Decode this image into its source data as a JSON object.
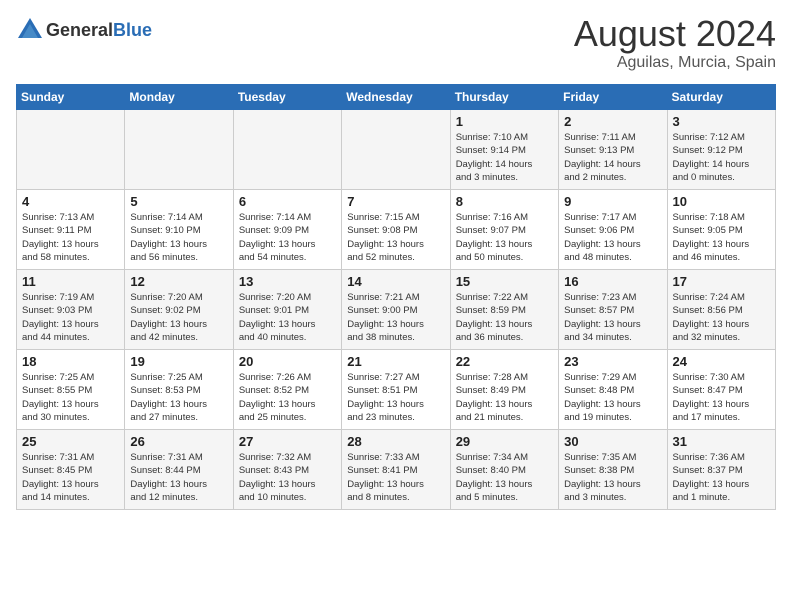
{
  "header": {
    "logo_general": "General",
    "logo_blue": "Blue",
    "month_year": "August 2024",
    "location": "Aguilas, Murcia, Spain"
  },
  "days_of_week": [
    "Sunday",
    "Monday",
    "Tuesday",
    "Wednesday",
    "Thursday",
    "Friday",
    "Saturday"
  ],
  "weeks": [
    [
      {
        "day": "",
        "info": ""
      },
      {
        "day": "",
        "info": ""
      },
      {
        "day": "",
        "info": ""
      },
      {
        "day": "",
        "info": ""
      },
      {
        "day": "1",
        "info": "Sunrise: 7:10 AM\nSunset: 9:14 PM\nDaylight: 14 hours\nand 3 minutes."
      },
      {
        "day": "2",
        "info": "Sunrise: 7:11 AM\nSunset: 9:13 PM\nDaylight: 14 hours\nand 2 minutes."
      },
      {
        "day": "3",
        "info": "Sunrise: 7:12 AM\nSunset: 9:12 PM\nDaylight: 14 hours\nand 0 minutes."
      }
    ],
    [
      {
        "day": "4",
        "info": "Sunrise: 7:13 AM\nSunset: 9:11 PM\nDaylight: 13 hours\nand 58 minutes."
      },
      {
        "day": "5",
        "info": "Sunrise: 7:14 AM\nSunset: 9:10 PM\nDaylight: 13 hours\nand 56 minutes."
      },
      {
        "day": "6",
        "info": "Sunrise: 7:14 AM\nSunset: 9:09 PM\nDaylight: 13 hours\nand 54 minutes."
      },
      {
        "day": "7",
        "info": "Sunrise: 7:15 AM\nSunset: 9:08 PM\nDaylight: 13 hours\nand 52 minutes."
      },
      {
        "day": "8",
        "info": "Sunrise: 7:16 AM\nSunset: 9:07 PM\nDaylight: 13 hours\nand 50 minutes."
      },
      {
        "day": "9",
        "info": "Sunrise: 7:17 AM\nSunset: 9:06 PM\nDaylight: 13 hours\nand 48 minutes."
      },
      {
        "day": "10",
        "info": "Sunrise: 7:18 AM\nSunset: 9:05 PM\nDaylight: 13 hours\nand 46 minutes."
      }
    ],
    [
      {
        "day": "11",
        "info": "Sunrise: 7:19 AM\nSunset: 9:03 PM\nDaylight: 13 hours\nand 44 minutes."
      },
      {
        "day": "12",
        "info": "Sunrise: 7:20 AM\nSunset: 9:02 PM\nDaylight: 13 hours\nand 42 minutes."
      },
      {
        "day": "13",
        "info": "Sunrise: 7:20 AM\nSunset: 9:01 PM\nDaylight: 13 hours\nand 40 minutes."
      },
      {
        "day": "14",
        "info": "Sunrise: 7:21 AM\nSunset: 9:00 PM\nDaylight: 13 hours\nand 38 minutes."
      },
      {
        "day": "15",
        "info": "Sunrise: 7:22 AM\nSunset: 8:59 PM\nDaylight: 13 hours\nand 36 minutes."
      },
      {
        "day": "16",
        "info": "Sunrise: 7:23 AM\nSunset: 8:57 PM\nDaylight: 13 hours\nand 34 minutes."
      },
      {
        "day": "17",
        "info": "Sunrise: 7:24 AM\nSunset: 8:56 PM\nDaylight: 13 hours\nand 32 minutes."
      }
    ],
    [
      {
        "day": "18",
        "info": "Sunrise: 7:25 AM\nSunset: 8:55 PM\nDaylight: 13 hours\nand 30 minutes."
      },
      {
        "day": "19",
        "info": "Sunrise: 7:25 AM\nSunset: 8:53 PM\nDaylight: 13 hours\nand 27 minutes."
      },
      {
        "day": "20",
        "info": "Sunrise: 7:26 AM\nSunset: 8:52 PM\nDaylight: 13 hours\nand 25 minutes."
      },
      {
        "day": "21",
        "info": "Sunrise: 7:27 AM\nSunset: 8:51 PM\nDaylight: 13 hours\nand 23 minutes."
      },
      {
        "day": "22",
        "info": "Sunrise: 7:28 AM\nSunset: 8:49 PM\nDaylight: 13 hours\nand 21 minutes."
      },
      {
        "day": "23",
        "info": "Sunrise: 7:29 AM\nSunset: 8:48 PM\nDaylight: 13 hours\nand 19 minutes."
      },
      {
        "day": "24",
        "info": "Sunrise: 7:30 AM\nSunset: 8:47 PM\nDaylight: 13 hours\nand 17 minutes."
      }
    ],
    [
      {
        "day": "25",
        "info": "Sunrise: 7:31 AM\nSunset: 8:45 PM\nDaylight: 13 hours\nand 14 minutes."
      },
      {
        "day": "26",
        "info": "Sunrise: 7:31 AM\nSunset: 8:44 PM\nDaylight: 13 hours\nand 12 minutes."
      },
      {
        "day": "27",
        "info": "Sunrise: 7:32 AM\nSunset: 8:43 PM\nDaylight: 13 hours\nand 10 minutes."
      },
      {
        "day": "28",
        "info": "Sunrise: 7:33 AM\nSunset: 8:41 PM\nDaylight: 13 hours\nand 8 minutes."
      },
      {
        "day": "29",
        "info": "Sunrise: 7:34 AM\nSunset: 8:40 PM\nDaylight: 13 hours\nand 5 minutes."
      },
      {
        "day": "30",
        "info": "Sunrise: 7:35 AM\nSunset: 8:38 PM\nDaylight: 13 hours\nand 3 minutes."
      },
      {
        "day": "31",
        "info": "Sunrise: 7:36 AM\nSunset: 8:37 PM\nDaylight: 13 hours\nand 1 minute."
      }
    ]
  ]
}
